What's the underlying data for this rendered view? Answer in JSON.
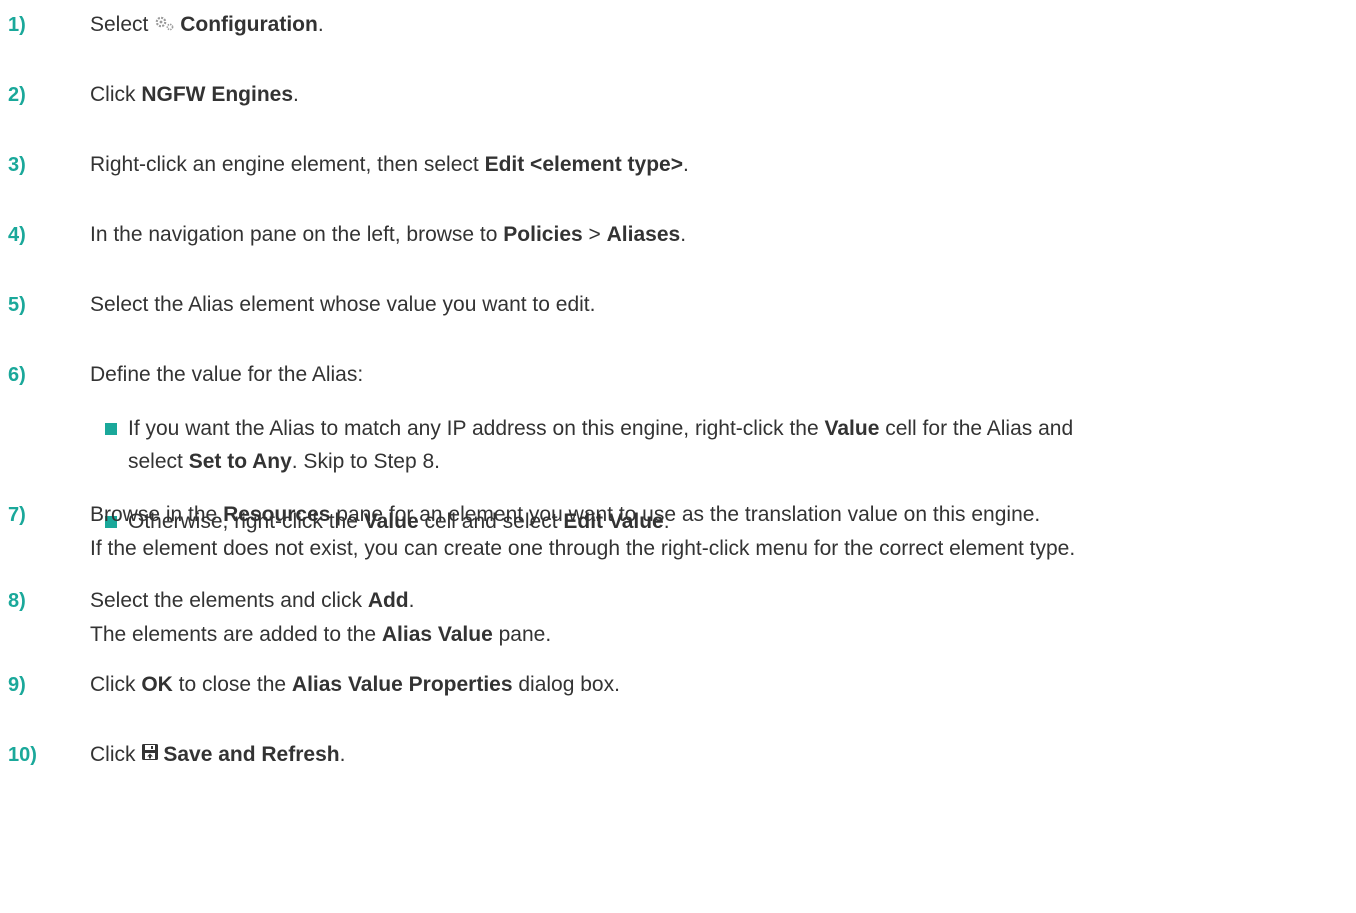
{
  "colors": {
    "accent": "#1aa89a",
    "text": "#333333"
  },
  "steps": [
    {
      "num": "1)",
      "parts": [
        {
          "t": "Select "
        },
        {
          "icon": "gear-icon"
        },
        {
          "t": "Configuration",
          "b": true
        },
        {
          "t": "."
        }
      ]
    },
    {
      "num": "2)",
      "parts": [
        {
          "t": "Click "
        },
        {
          "t": "NGFW Engines",
          "b": true
        },
        {
          "t": "."
        }
      ]
    },
    {
      "num": "3)",
      "parts": [
        {
          "t": "Right-click an engine element, then select "
        },
        {
          "t": "Edit <element type>",
          "b": true
        },
        {
          "t": "."
        }
      ]
    },
    {
      "num": "4)",
      "parts": [
        {
          "t": "In the navigation pane on the left, browse to "
        },
        {
          "t": "Policies",
          "b": true
        },
        {
          "t": " > "
        },
        {
          "t": "Aliases",
          "b": true
        },
        {
          "t": "."
        }
      ]
    },
    {
      "num": "5)",
      "parts": [
        {
          "t": "Select the Alias element whose value you want to edit."
        }
      ]
    },
    {
      "num": "6)",
      "parts": [
        {
          "t": "Define the value for the Alias:"
        }
      ],
      "bullets": [
        {
          "lines": [
            [
              {
                "t": "If you want the Alias to match any IP address on this engine, right-click the "
              },
              {
                "t": "Value",
                "b": true
              },
              {
                "t": " cell for the Alias and"
              }
            ],
            [
              {
                "t": "select "
              },
              {
                "t": "Set to Any",
                "b": true
              },
              {
                "t": ". Skip to Step 8."
              }
            ]
          ]
        },
        {
          "lines": [
            [
              {
                "t": "Otherwise, right-click the "
              },
              {
                "t": "Value",
                "b": true
              },
              {
                "t": " cell and select "
              },
              {
                "t": "Edit Value",
                "b": true
              },
              {
                "t": "."
              }
            ]
          ]
        }
      ]
    },
    {
      "num": "7)",
      "parts": [
        {
          "t": "Browse in the "
        },
        {
          "t": "Resources",
          "b": true
        },
        {
          "t": " pane for an element you want to use as the translation value on this engine."
        }
      ],
      "extra": [
        {
          "t": "If the element does not exist, you can create one through the right-click menu for the correct element type."
        }
      ]
    },
    {
      "num": "8)",
      "parts": [
        {
          "t": "Select the elements and click "
        },
        {
          "t": "Add",
          "b": true
        },
        {
          "t": "."
        }
      ],
      "extra": [
        {
          "t": "The elements are added to the "
        },
        {
          "t": "Alias Value",
          "b": true
        },
        {
          "t": " pane."
        }
      ]
    },
    {
      "num": "9)",
      "parts": [
        {
          "t": "Click "
        },
        {
          "t": "OK",
          "b": true
        },
        {
          "t": " to close the "
        },
        {
          "t": "Alias Value Properties",
          "b": true
        },
        {
          "t": " dialog box."
        }
      ]
    },
    {
      "num": "10)",
      "parts": [
        {
          "t": "Click "
        },
        {
          "icon": "save-icon"
        },
        {
          "t": "Save and Refresh",
          "b": true
        },
        {
          "t": "."
        }
      ]
    }
  ]
}
